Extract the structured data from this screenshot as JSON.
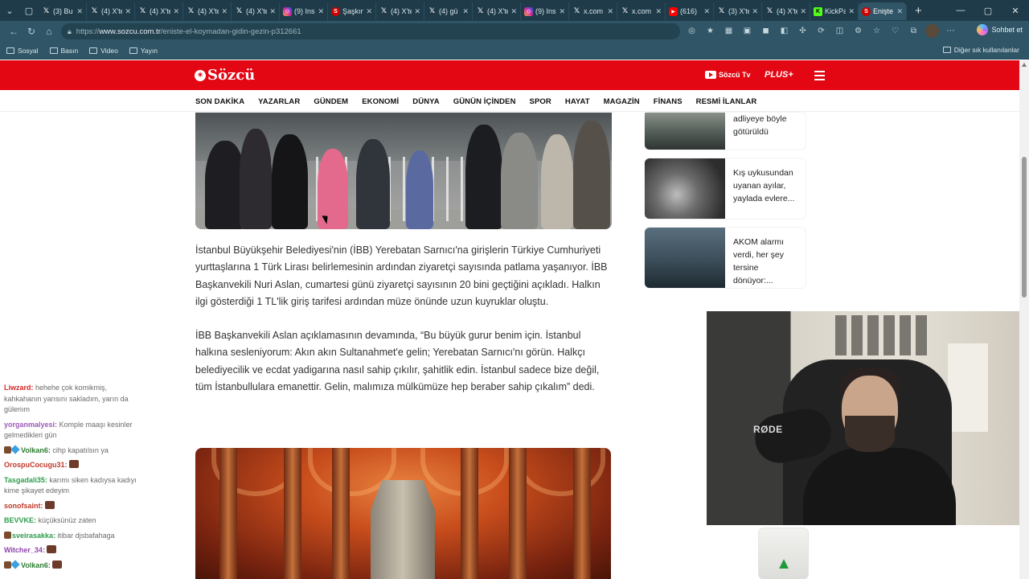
{
  "browser": {
    "tabs": [
      {
        "icon": "x-icon",
        "label": "(3) Bu",
        "active": false
      },
      {
        "icon": "x-icon",
        "label": "(4) X'te",
        "active": false
      },
      {
        "icon": "x-icon",
        "label": "(4) X'te",
        "active": false
      },
      {
        "icon": "x-icon",
        "label": "(4) X'te",
        "active": false
      },
      {
        "icon": "x-icon",
        "label": "(4) X'te",
        "active": false
      },
      {
        "icon": "instagram-icon",
        "label": "(9) Ins",
        "active": false
      },
      {
        "icon": "sozcu-icon",
        "label": "Şaşkın",
        "active": false
      },
      {
        "icon": "x-icon",
        "label": "(4) X'te",
        "active": false
      },
      {
        "icon": "x-icon",
        "label": "(4) gü",
        "active": false
      },
      {
        "icon": "x-icon",
        "label": "(4) X'te",
        "active": false
      },
      {
        "icon": "instagram-icon",
        "label": "(9) Ins",
        "active": false
      },
      {
        "icon": "x-icon",
        "label": "x.com",
        "active": false
      },
      {
        "icon": "x-icon",
        "label": "x.com",
        "active": false
      },
      {
        "icon": "youtube-icon",
        "label": "(616)",
        "active": false
      },
      {
        "icon": "x-icon",
        "label": "(3) X'te",
        "active": false
      },
      {
        "icon": "x-icon",
        "label": "(4) X'te",
        "active": false
      },
      {
        "icon": "kick-icon",
        "label": "KickPa",
        "active": false
      },
      {
        "icon": "sozcu-icon",
        "label": "Enişte",
        "active": true
      }
    ],
    "address": {
      "prefix": "https://",
      "domain": "www.sozcu.com.tr",
      "path": "/eniste-el-koymadan-gidin-gezin-p312661"
    },
    "copilot_label": "Sohbet et",
    "bookmarks": [
      "Sosyal",
      "Basın",
      "Video",
      "Yayın"
    ],
    "other_bookmarks": "Diğer sık kullanılanlar"
  },
  "site": {
    "logo": "Sözcü",
    "tv_label": "Sözcü Tv",
    "plus_label": "PLUS+",
    "nav": [
      "SON DAKİKA",
      "YAZARLAR",
      "GÜNDEM",
      "EKONOMİ",
      "DÜNYA",
      "GÜNÜN İÇİNDEN",
      "SPOR",
      "HAYAT",
      "MAGAZİN",
      "FİNANS",
      "RESMİ İLANLAR"
    ]
  },
  "article": {
    "paragraphs": [
      "İstanbul Büyükşehir Belediyesi'nin (İBB) Yerebatan Sarnıcı'na girişlerin Türkiye Cumhuriyeti yurttaşlarına 1 Türk Lirası belirlemesinin ardından ziyaretçi sayısında patlama yaşanıyor. İBB Başkanvekili Nuri Aslan, cumartesi günü ziyaretçi sayısının 20 bini geçtiğini açıkladı. Halkın ilgi gösterdiği 1 TL'lik giriş tarifesi ardından müze önünde uzun kuyruklar oluştu.",
      "İBB Başkanvekili Aslan açıklamasının devamında, “Bu büyük gurur benim için. İstanbul halkına sesleniyorum: Akın akın Sultanahmet'e gelin; Yerebatan Sarnıcı'nı görün. Halkçı belediyecilik ve ecdat yadigarına nasıl sahip çıkılır, şahitlik edin. İstanbul sadece bize değil, tüm İstanbullulara emanettir. Gelin, malımıza mülkümüze hep beraber sahip çıkalım” dedi."
    ]
  },
  "sidebar": {
    "cards": [
      {
        "title": "adliyeye böyle götürüldü"
      },
      {
        "title": "Kış uykusundan uyanan ayılar, yaylada evlere..."
      },
      {
        "title": "AKOM alarmı verdi, her şey tersine dönüyor:..."
      }
    ]
  },
  "stream": {
    "chat": [
      {
        "user": "Liwzard",
        "color": "#d62828",
        "text": "hehehe çok komikmiş, kahkahanın yarısını sakladım, yarın da güleriım"
      },
      {
        "user": "yorganmalyesi",
        "color": "#9b59b6",
        "text": "Komple maaşı kesinler gelmedikleri gün"
      },
      {
        "user": "Volkan6",
        "color": "#2e7d32",
        "text": "cihp kapatılsın ya"
      },
      {
        "user": "OrospuCocugu31",
        "color": "#c0392b",
        "text": ""
      },
      {
        "user": "Tasgadali35",
        "color": "#2e9d4e",
        "text": "karımı siken kadıysa kadıyı kime şikayet edeyim"
      },
      {
        "user": "sonofsaint",
        "color": "#c0392b",
        "text": ""
      },
      {
        "user": "BEVVKE",
        "color": "#2e9d4e",
        "text": "küçüksünüz zaten"
      },
      {
        "user": "sveirasakka",
        "color": "#2e9d4e",
        "text": "itibar djsbafahaga"
      },
      {
        "user": "Witcher_34",
        "color": "#8e44ad",
        "text": ""
      },
      {
        "user": "Volkan6",
        "color": "#2e7d32",
        "text": ""
      }
    ],
    "mic_brand": "RØDE"
  }
}
